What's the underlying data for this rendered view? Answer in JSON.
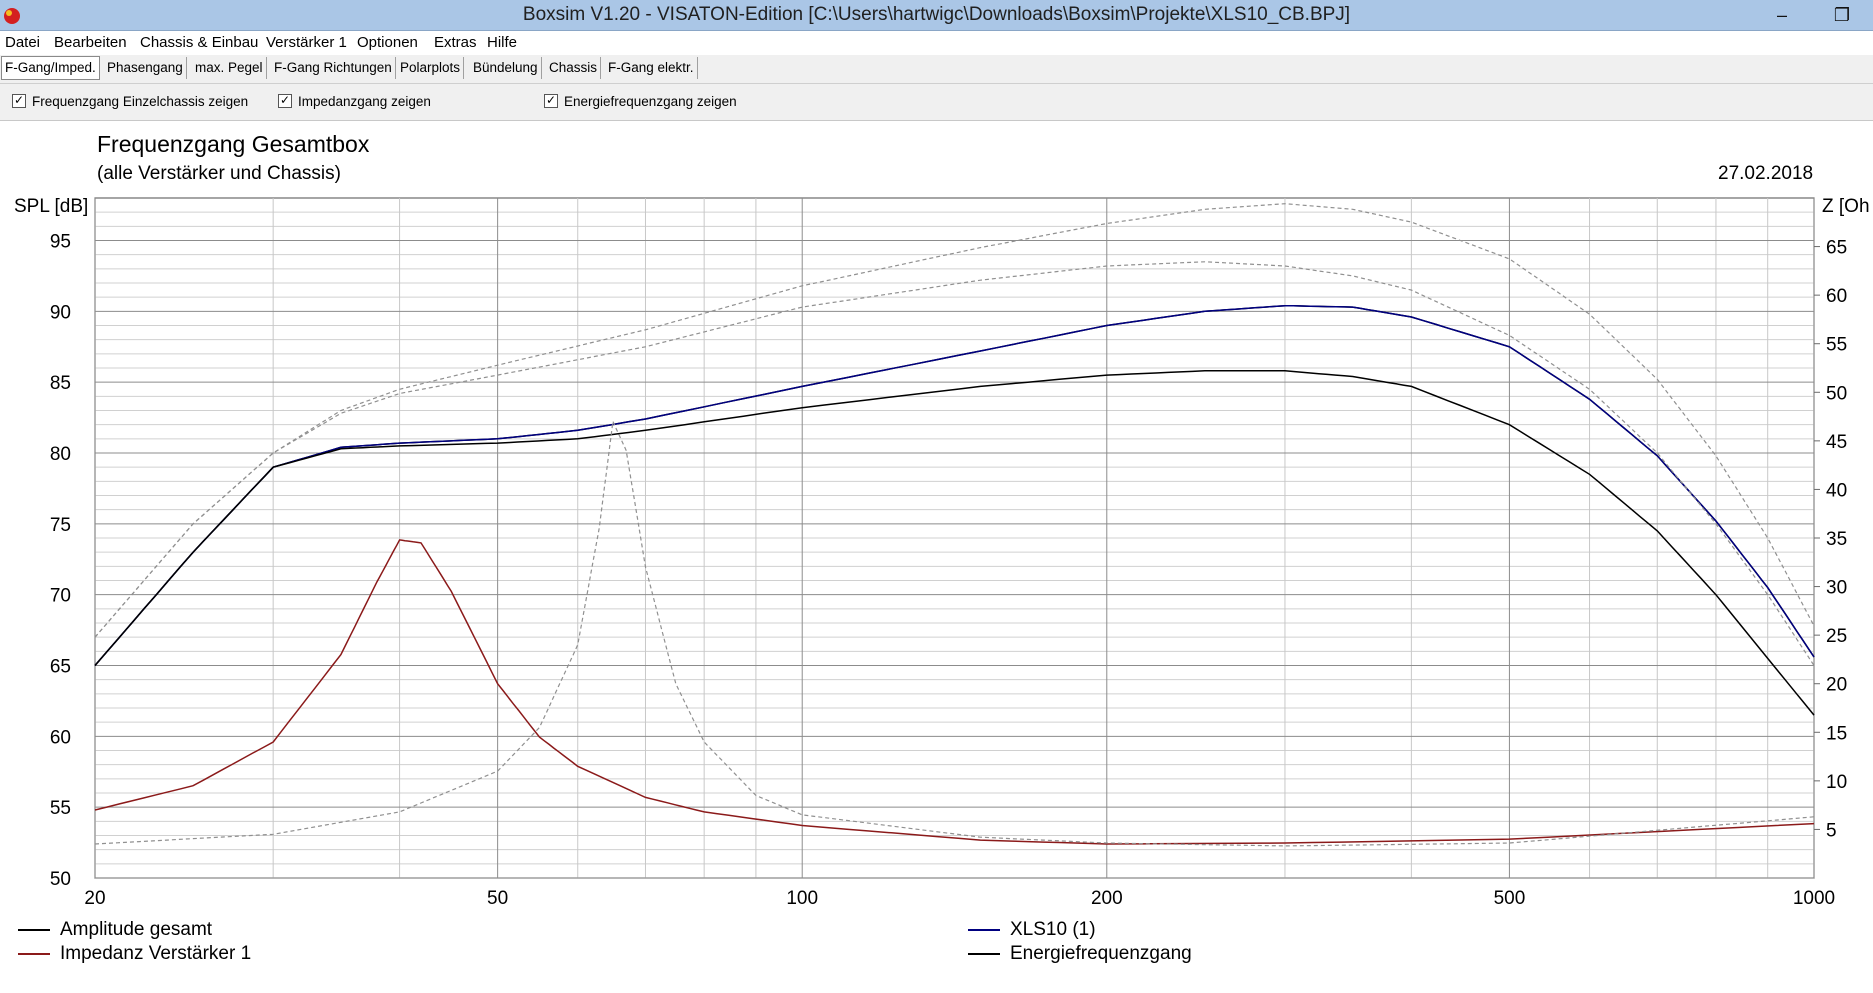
{
  "window": {
    "title": "Boxsim V1.20 - VISATON-Edition [C:\\Users\\hartwigc\\Downloads\\Boxsim\\Projekte\\XLS10_CB.BPJ]",
    "minimize_glyph": "–",
    "restore_glyph": "❐",
    "app_icon": "boxsim-app-icon"
  },
  "menu": [
    "Datei",
    "Bearbeiten",
    "Chassis & Einbau",
    "Verstärker 1",
    "Optionen",
    "Extras",
    "Hilfe"
  ],
  "tabs": [
    {
      "label": "F-Gang/Imped.",
      "active": true
    },
    {
      "label": "Phasengang",
      "active": false
    },
    {
      "label": "max. Pegel",
      "active": false
    },
    {
      "label": "F-Gang Richtungen",
      "active": false
    },
    {
      "label": "Polarplots",
      "active": false
    },
    {
      "label": "Bündelung",
      "active": false
    },
    {
      "label": "Chassis",
      "active": false
    },
    {
      "label": "F-Gang elektr.",
      "active": false
    }
  ],
  "options": [
    {
      "label": "Frequenzgang Einzelchassis zeigen",
      "checked": true
    },
    {
      "label": "Impedanzgang zeigen",
      "checked": true
    },
    {
      "label": "Energiefrequenzgang zeigen",
      "checked": true
    }
  ],
  "check_glyph": "✓",
  "chart_header": {
    "title": "Frequenzgang Gesamtbox",
    "subtitle": "(alle Verstärker und Chassis)",
    "date": "27.02.2018"
  },
  "chart_data": {
    "type": "line",
    "x_scale": "log",
    "xlim": [
      20,
      1000
    ],
    "x_ticks": [
      20,
      50,
      100,
      200,
      500,
      1000
    ],
    "ylabel": "SPL [dB]",
    "ylim": [
      50,
      98
    ],
    "y_ticks": [
      50,
      55,
      60,
      65,
      70,
      75,
      80,
      85,
      90,
      95
    ],
    "y2label": "Z [Oh",
    "y2lim": [
      0,
      70
    ],
    "y2_ticks": [
      5,
      10,
      15,
      20,
      25,
      30,
      35,
      40,
      45,
      50,
      55,
      60,
      65
    ],
    "grid": true,
    "series": [
      {
        "name": "Amplitude gesamt",
        "axis": "left",
        "color": "#000000",
        "dashed": false,
        "x": [
          20,
          25,
          30,
          35,
          40,
          50,
          60,
          70,
          100,
          150,
          200,
          250,
          300,
          350,
          400,
          500,
          600,
          700,
          800,
          900,
          1000
        ],
        "y": [
          65,
          73,
          79,
          80.4,
          80.7,
          81,
          81.6,
          82.4,
          84.7,
          87.2,
          89,
          90,
          90.4,
          90.3,
          89.6,
          87.5,
          83.8,
          79.8,
          75.2,
          70.5,
          65.6
        ]
      },
      {
        "name": "XLS10 (1)",
        "axis": "left",
        "color": "#000080",
        "dashed": false,
        "x": [
          20,
          25,
          30,
          35,
          40,
          50,
          60,
          70,
          100,
          150,
          200,
          250,
          300,
          350,
          400,
          500,
          600,
          700,
          800,
          900,
          1000
        ],
        "y": [
          65,
          73,
          79,
          80.4,
          80.7,
          81,
          81.6,
          82.4,
          84.7,
          87.2,
          89,
          90,
          90.4,
          90.3,
          89.6,
          87.5,
          83.8,
          79.8,
          75.2,
          70.5,
          65.6
        ]
      },
      {
        "name": "Energiefrequenzgang",
        "axis": "left",
        "color": "#000000",
        "dashed": false,
        "x": [
          20,
          25,
          30,
          35,
          40,
          50,
          60,
          70,
          100,
          150,
          200,
          250,
          300,
          350,
          400,
          500,
          600,
          700,
          800,
          900,
          1000
        ],
        "y": [
          65,
          73,
          79,
          80.3,
          80.5,
          80.7,
          81,
          81.6,
          83.2,
          84.7,
          85.5,
          85.8,
          85.8,
          85.4,
          84.7,
          82,
          78.5,
          74.5,
          70,
          65.5,
          61.5
        ]
      },
      {
        "name": "Impedanz Verstärker 1",
        "axis": "right",
        "color": "#8b1a1a",
        "dashed": false,
        "x": [
          20,
          25,
          30,
          35,
          38,
          40,
          42,
          45,
          50,
          55,
          60,
          70,
          80,
          100,
          150,
          200,
          300,
          500,
          1000
        ],
        "y": [
          7,
          9.5,
          14,
          23,
          30.5,
          34.8,
          34.5,
          29.5,
          20,
          14.5,
          11.5,
          8.3,
          6.8,
          5.4,
          3.9,
          3.5,
          3.6,
          4,
          5.6
        ]
      },
      {
        "name": "",
        "axis": "left",
        "color": "#909090",
        "dashed": true,
        "x": [
          20,
          25,
          30,
          35,
          40,
          50,
          70,
          100,
          150,
          200,
          250,
          300,
          350,
          400,
          500,
          600,
          700,
          800,
          900,
          1000
        ],
        "y": [
          67,
          75,
          80,
          83,
          84.5,
          86.2,
          88.7,
          91.8,
          94.5,
          96.2,
          97.2,
          97.6,
          97.2,
          96.3,
          93.7,
          89.8,
          85.2,
          79.8,
          74,
          67.8
        ]
      },
      {
        "name": "",
        "axis": "left",
        "color": "#909090",
        "dashed": true,
        "x": [
          20,
          25,
          30,
          35,
          40,
          50,
          70,
          100,
          150,
          200,
          250,
          300,
          350,
          400,
          500,
          600,
          700,
          800,
          900,
          1000
        ],
        "y": [
          67,
          75,
          80,
          82.8,
          84.2,
          85.5,
          87.5,
          90.3,
          92.2,
          93.2,
          93.5,
          93.2,
          92.5,
          91.5,
          88.3,
          84.5,
          80,
          75,
          70,
          65
        ]
      },
      {
        "name": "",
        "axis": "right",
        "color": "#909090",
        "dashed": true,
        "x": [
          20,
          30,
          40,
          50,
          55,
          60,
          63,
          65,
          67,
          70,
          75,
          80,
          90,
          100,
          150,
          200,
          300,
          500,
          1000
        ],
        "y": [
          3.5,
          4.5,
          6.8,
          11,
          15.5,
          24,
          36,
          47,
          44,
          32,
          20,
          14,
          8.5,
          6.5,
          4.2,
          3.6,
          3.3,
          3.6,
          6.3
        ]
      }
    ]
  },
  "legend": [
    {
      "label": "Amplitude gesamt",
      "color": "#000000"
    },
    {
      "label": "Impedanz Verstärker 1",
      "color": "#8b1a1a"
    },
    {
      "label": "XLS10 (1)",
      "color": "#000080"
    },
    {
      "label": "Energiefrequenzgang",
      "color": "#000000"
    }
  ]
}
